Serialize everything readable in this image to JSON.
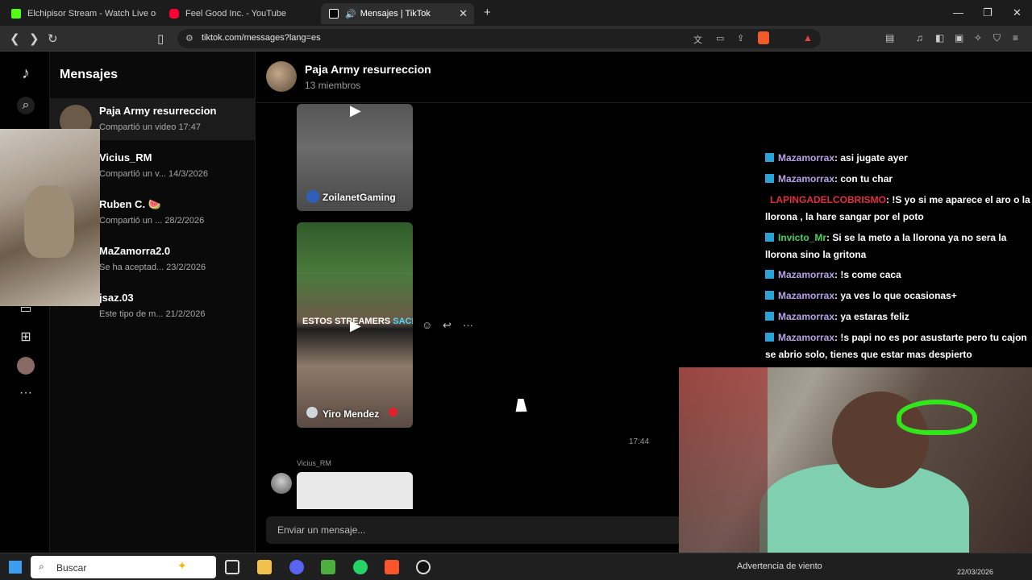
{
  "browser": {
    "tabs": [
      {
        "title": "Elchipisor Stream - Watch Live on Kic",
        "favicon_color": "#53fc18"
      },
      {
        "title": "Feel Good Inc. - YouTube",
        "favicon_color": "#ff0033"
      },
      {
        "title": "Mensajes | TikTok",
        "favicon_color": "#ffffff"
      }
    ],
    "url": "tiktok.com/messages?lang=es"
  },
  "sidebar": {
    "title": "Mensajes",
    "conversations": [
      {
        "name": "Paja Army resurreccion",
        "preview": "Compartió un video  17:47"
      },
      {
        "name": "Vicius_RM",
        "preview": "Compartió un v...  14/3/2026"
      },
      {
        "name": "Ruben C. 🍉",
        "preview": "Compartió un ...  28/2/2026"
      },
      {
        "name": "MaZamorra2.0",
        "preview": "Se ha aceptad...  23/2/2026"
      },
      {
        "name": "jsaz.03",
        "preview": "Este tipo de m...  21/2/2026"
      }
    ]
  },
  "chat": {
    "group_name": "Paja Army resurreccion",
    "members": "13 miembros",
    "videos": [
      {
        "author": "ZoilanetGaming"
      },
      {
        "author": "Yiro Mendez",
        "caption_white": "ESTOS STREAMERS",
        "caption_cyan": "SACHA"
      }
    ],
    "timestamp": "17:44",
    "last_sender": "Vicius_RM",
    "input_placeholder": "Enviar un mensaje..."
  },
  "stream_chat": [
    {
      "user": "Mazamorrax",
      "text": ": asi jugate ayer",
      "color": "#b7a3e6"
    },
    {
      "user": "Mazamorrax",
      "text": ": con tu char",
      "color": "#b7a3e6"
    },
    {
      "user": "LAPINGADELCOBRISMO",
      "text": ": !S yo si me aparece el aro o la llorona , la hare sangar por el poto",
      "color": "#e0303b"
    },
    {
      "user": "Invicto_Mr",
      "text": ": Si se la meto a la llorona ya no sera la llorona sino la gritona",
      "color": "#3fd45a"
    },
    {
      "user": "Mazamorrax",
      "text": ": !s come caca",
      "color": "#b7a3e6"
    },
    {
      "user": "Mazamorrax",
      "text": ": ya ves lo que ocasionas+",
      "color": "#b7a3e6"
    },
    {
      "user": "Mazamorrax",
      "text": ": ya estaras feliz",
      "color": "#b7a3e6"
    },
    {
      "user": "Mazamorrax",
      "text": ": !s papi no es por asustarte pero tu cajon se abrio solo, tienes que estar mas despierto",
      "color": "#b7a3e6"
    }
  ],
  "taskbar": {
    "search_placeholder": "Buscar",
    "weather": "Advertencia de viento",
    "date": "22/03/2026"
  }
}
